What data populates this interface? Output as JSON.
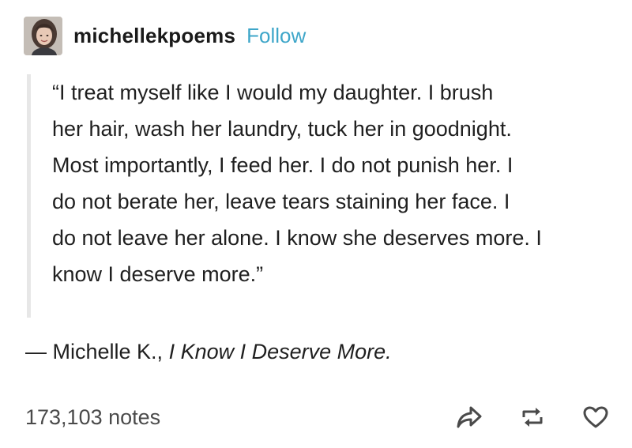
{
  "post": {
    "username": "michellekpoems",
    "follow_label": "Follow",
    "quote_lines": [
      "“I treat myself like I would my daughter. I brush",
      "her hair, wash her laundry, tuck her in goodnight.",
      "Most importantly, I feed her. I do not punish her. I",
      "do not berate her, leave tears staining her face. I",
      "do not leave her alone. I know she deserves more. I",
      "know I deserve more.”"
    ],
    "attribution_prefix": "— Michelle K., ",
    "attribution_title": "I Know I Deserve More.",
    "notes": "173,103 notes"
  },
  "colors": {
    "follow": "#3ea6c9",
    "quote_bar": "#e7e7e7",
    "text": "#1f1f1f"
  },
  "icons": {
    "share": "share-arrow-icon",
    "reblog": "reblog-icon",
    "like": "heart-icon"
  }
}
